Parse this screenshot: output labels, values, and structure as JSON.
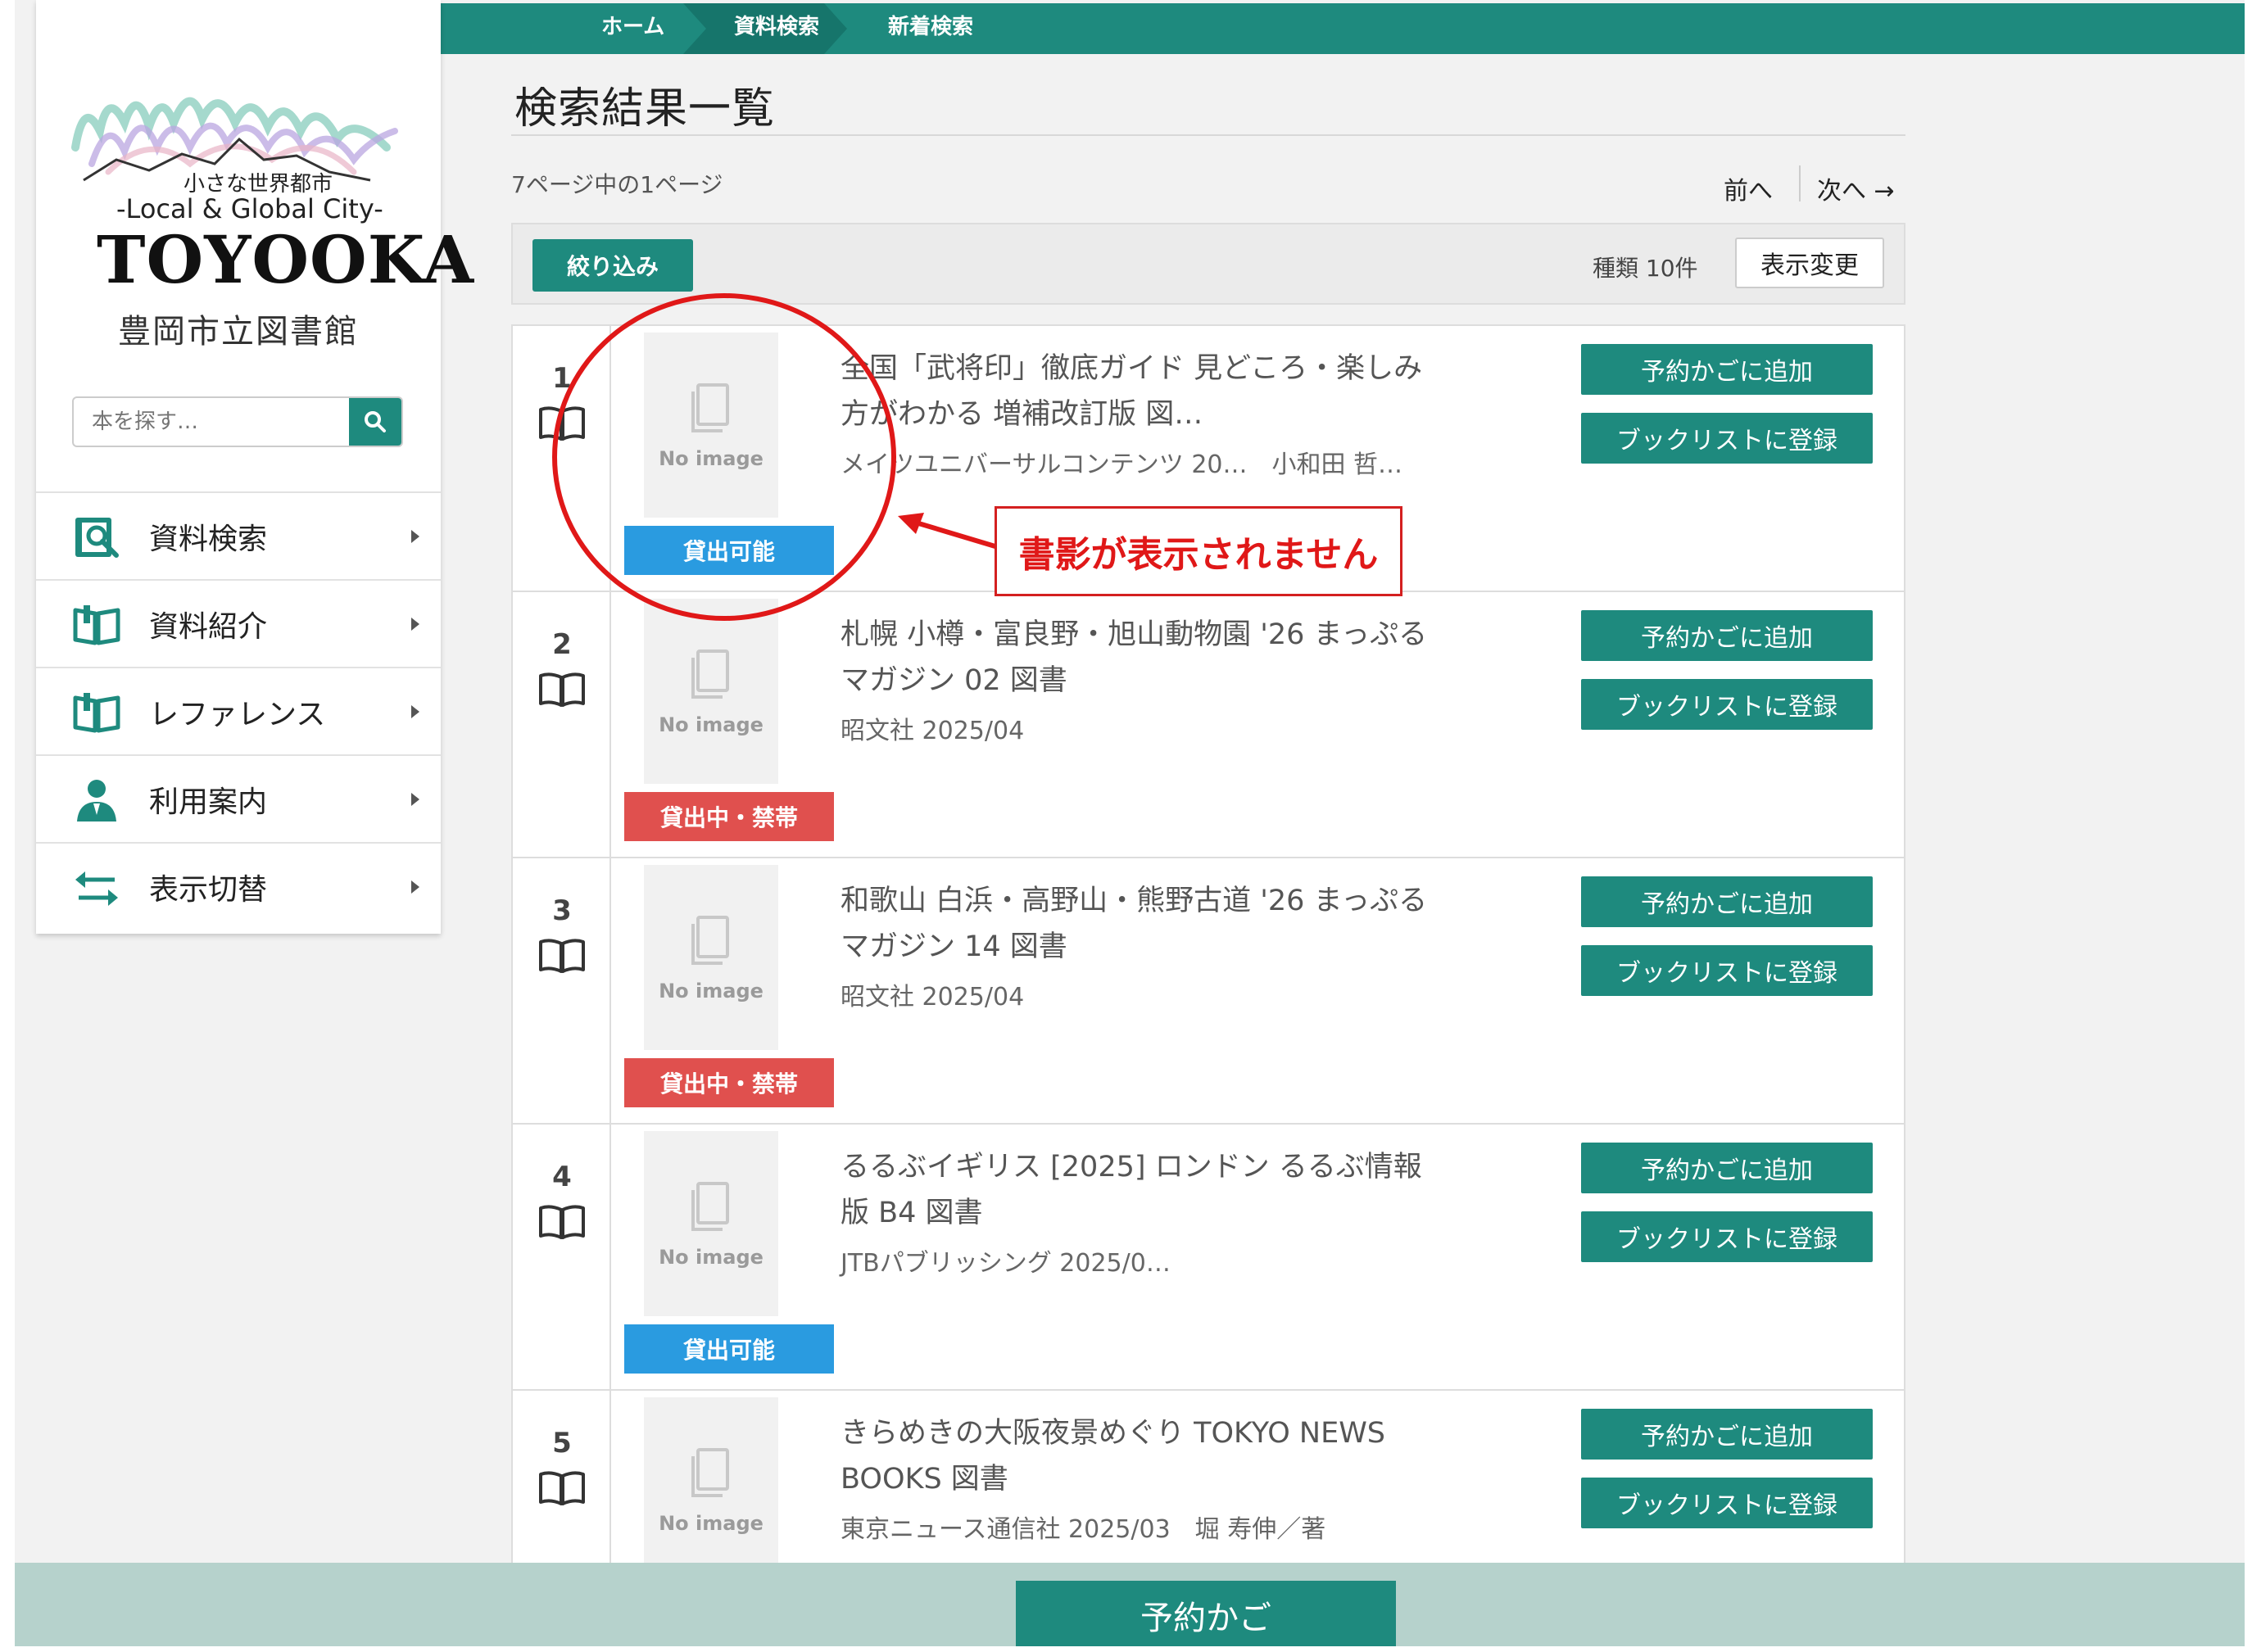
{
  "topnav": {
    "items": [
      {
        "label": "ホーム"
      },
      {
        "label": "資料検索"
      },
      {
        "label": "新着検索"
      }
    ]
  },
  "sidebar": {
    "logo": {
      "sub1": "小さな世界都市",
      "sub2": "-Local & Global City-",
      "main": "TOYOOKA"
    },
    "library_name": "豊岡市立図書館",
    "search": {
      "placeholder": "本を探す…"
    },
    "nav": [
      {
        "label": "資料検索",
        "icon": "search-book-icon"
      },
      {
        "label": "資料紹介",
        "icon": "open-book-icon"
      },
      {
        "label": "レファレンス",
        "icon": "open-book-icon"
      },
      {
        "label": "利用案内",
        "icon": "person-icon"
      },
      {
        "label": "表示切替",
        "icon": "switch-arrows-icon"
      }
    ]
  },
  "main": {
    "title": "検索結果一覧",
    "page_count": "7ページ中の1ページ",
    "pager": {
      "prev": "前へ",
      "next": "次へ →"
    },
    "toolbar": {
      "filter": "絞り込み",
      "kind_count": "種類 10件",
      "display_change": "表示変更"
    }
  },
  "results": [
    {
      "num": "1",
      "thumb_text": "No image",
      "status": "貸出可能",
      "status_type": "ok",
      "title": "全国「武将印」徹底ガイド 見どころ・楽しみ方がわかる 増補改訂版 図…",
      "meta": "メイツユニバーサルコンテンツ 20…　小和田 哲…",
      "reserve": "予約かごに追加",
      "booklist": "ブックリストに登録"
    },
    {
      "num": "2",
      "thumb_text": "No image",
      "status": "貸出中・禁帯",
      "status_type": "ng",
      "title": "札幌 小樽・富良野・旭山動物園 '26 まっぷるマガジン 02 図書",
      "meta": "昭文社 2025/04",
      "reserve": "予約かごに追加",
      "booklist": "ブックリストに登録"
    },
    {
      "num": "3",
      "thumb_text": "No image",
      "status": "貸出中・禁帯",
      "status_type": "ng",
      "title": "和歌山 白浜・高野山・熊野古道 '26 まっぷるマガジン 14 図書",
      "meta": "昭文社 2025/04",
      "reserve": "予約かごに追加",
      "booklist": "ブックリストに登録"
    },
    {
      "num": "4",
      "thumb_text": "No image",
      "status": "貸出可能",
      "status_type": "ok",
      "title": "るるぶイギリス [2025] ロンドン るるぶ情報版 B4 図書",
      "meta": "JTBパブリッシング 2025/0…",
      "reserve": "予約かごに追加",
      "booklist": "ブックリストに登録"
    },
    {
      "num": "5",
      "thumb_text": "No image",
      "status": "",
      "status_type": "none",
      "title": "きらめきの大阪夜景めぐり TOKYO NEWS BOOKS 図書",
      "meta": "東京ニュース通信社 2025/03　堀 寿伸／著",
      "reserve": "予約かごに追加",
      "booklist": "ブックリストに登録"
    }
  ],
  "annotation": {
    "text": "書影が表示されません",
    "color": "#e01818"
  },
  "footer": {
    "cart": "予約かご"
  },
  "colors": {
    "accent": "#1e8a7e",
    "status_ok": "#2a9be0",
    "status_ng": "#e0504e",
    "footer_bg": "#b6d2cc"
  }
}
